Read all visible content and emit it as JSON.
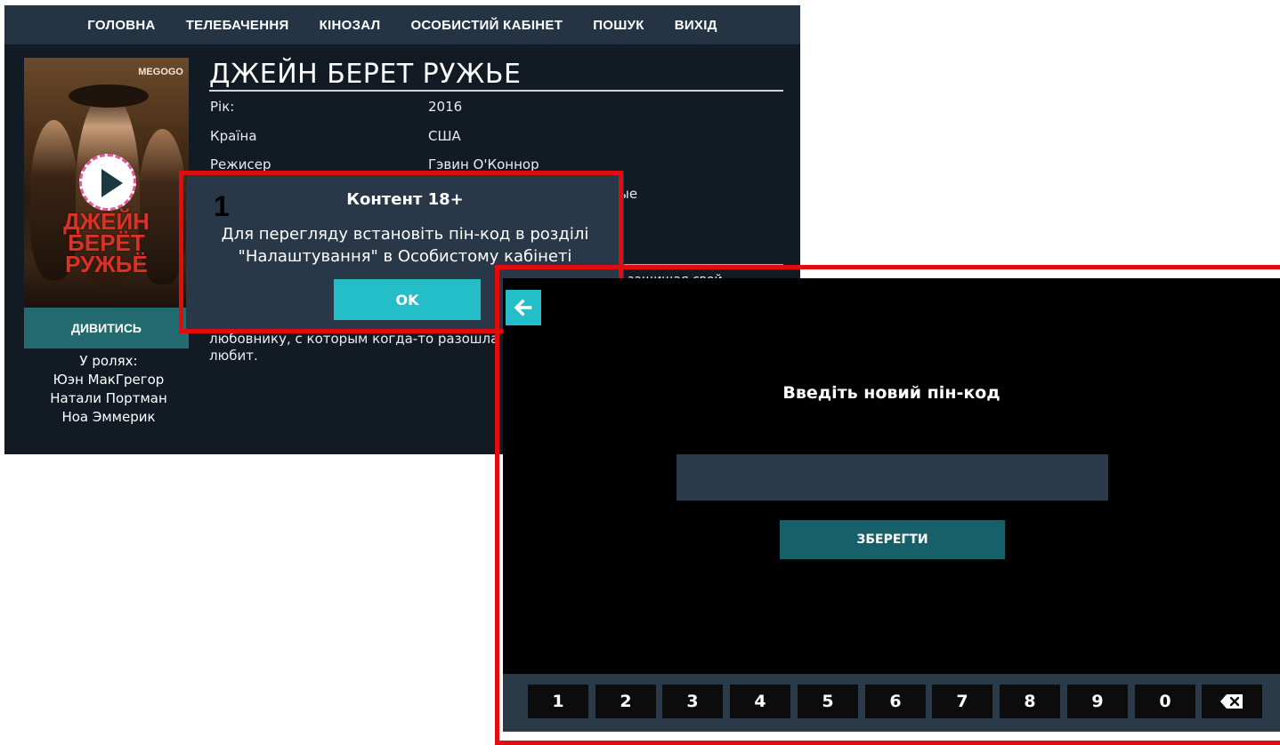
{
  "nav": {
    "items": [
      "ГОЛОВНА",
      "ТЕЛЕБАЧЕННЯ",
      "КІНОЗАЛ",
      "ОСОБИСТИЙ КАБІНЕТ",
      "ПОШУК",
      "ВИХІД"
    ]
  },
  "movie": {
    "title": "ДЖЕЙН БЕРЕТ РУЖЬЕ",
    "poster_brand": "MEGOGO",
    "poster_title": "ДЖЕЙН\nБЕРЁТ\nРУЖЬЁ",
    "watch_label": "ДИВИТИСЬ",
    "cast_heading": "У ролях:",
    "cast": [
      "Юэн МакГрегор",
      "Натали Портман",
      "Ноа Эммерик"
    ],
    "meta": [
      {
        "label": "Рік:",
        "value": "2016"
      },
      {
        "label": "Країна",
        "value": "США"
      },
      {
        "label": "Режисер",
        "value": "Гэвин О'Коннор"
      },
      {
        "label": "",
        "value": "ые"
      }
    ],
    "desc_fragment_top": "защищая свой",
    "description": "любовнику, с которым когда-то разошла",
    "description_end": "любит."
  },
  "modal": {
    "title": "Контент 18+",
    "text": "Для перегляду встановіть пін-код в розділі \"Налаштування\" в Особистому кабінеті",
    "ok_label": "OK",
    "marker": "1"
  },
  "pin_screen": {
    "prompt": "Введіть новий пін-код",
    "input_value": "",
    "save_label": "ЗБЕРЕГТИ",
    "keys": [
      "1",
      "2",
      "3",
      "4",
      "5",
      "6",
      "7",
      "8",
      "9",
      "0"
    ]
  },
  "colors": {
    "nav_bg": "#243444",
    "page_bg": "#121a23",
    "accent_cyan": "#23bec8",
    "teal_button": "#236b71",
    "highlight_red": "#e30b0b",
    "modal_bg": "#283848"
  },
  "icons": {
    "back": "arrow-left-icon",
    "backspace": "backspace-icon",
    "play": "play-icon"
  }
}
